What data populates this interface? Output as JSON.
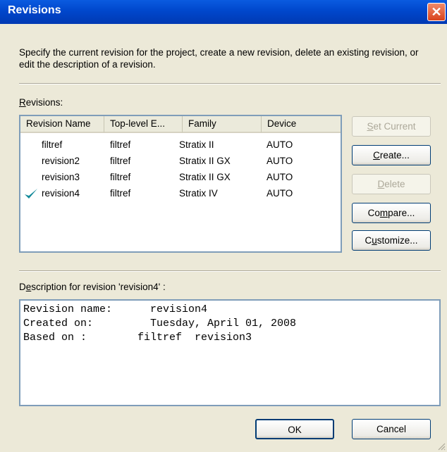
{
  "window": {
    "title": "Revisions",
    "close_glyph": "✕"
  },
  "intro": "Specify the current revision for the project, create a new revision, delete an existing revision, or edit the description of a revision.",
  "revisions_label": {
    "accel": "R",
    "rest": "evisions:"
  },
  "columns": [
    "Revision Name",
    "Top-level E...",
    "Family",
    "Device"
  ],
  "rows": [
    {
      "name": "filtref",
      "top": "filtref",
      "family": "Stratix II",
      "device": "AUTO",
      "current": false
    },
    {
      "name": "revision2",
      "top": "filtref",
      "family": "Stratix II GX",
      "device": "AUTO",
      "current": false
    },
    {
      "name": "revision3",
      "top": "filtref",
      "family": "Stratix II GX",
      "device": "AUTO",
      "current": false
    },
    {
      "name": "revision4",
      "top": "filtref",
      "family": "Stratix IV",
      "device": "AUTO",
      "current": true
    }
  ],
  "buttons": {
    "set_current": {
      "accel": "S",
      "rest": "et Current"
    },
    "create": {
      "accel": "C",
      "rest": "reate..."
    },
    "delete": {
      "accel": "D",
      "rest": "elete"
    },
    "compare": {
      "pre": "Co",
      "accel": "m",
      "rest": "pare..."
    },
    "customize": {
      "pre": "C",
      "accel": "u",
      "rest": "stomize..."
    },
    "ok": "OK",
    "cancel": "Cancel"
  },
  "description_label": {
    "pre": "D",
    "accel": "e",
    "rest": "scription for revision 'revision4' :"
  },
  "description_text": "Revision name:      revision4\nCreated on:         Tuesday, April 01, 2008\nBased on :        filtref  revision3",
  "icons": {
    "current": "checkmark-icon",
    "close": "close-icon",
    "grip": "resize-grip-icon"
  },
  "colors": {
    "title_bar": "#0047cc",
    "check": "#138a9a"
  }
}
